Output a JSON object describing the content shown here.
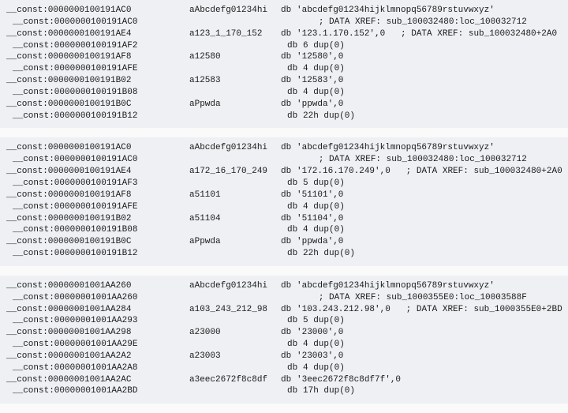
{
  "blocks": [
    {
      "rows": [
        {
          "label": "__const:0000000100191AC0",
          "sub": false,
          "symbol": "aAbcdefg01234hi",
          "kw": "db",
          "data": "'abcdefg01234hijklmnopq56789rstuvwxyz'",
          "xref": ""
        },
        {
          "label": "__const:0000000100191AC0",
          "sub": true,
          "symbol": "",
          "kw": "",
          "data": "",
          "xref": "; DATA XREF: sub_100032480:loc_100032712"
        },
        {
          "label": "__const:0000000100191AE4",
          "sub": false,
          "symbol": "a123_1_170_152",
          "kw": "db",
          "data": "'123.1.170.152',0",
          "xref": "; DATA XREF: sub_100032480+2A0"
        },
        {
          "label": "__const:0000000100191AF2",
          "sub": true,
          "symbol": "",
          "kw": "db",
          "data": "6 dup(0)",
          "xref": ""
        },
        {
          "label": "__const:0000000100191AF8",
          "sub": false,
          "symbol": "a12580",
          "kw": "db",
          "data": "'12580',0",
          "xref": ""
        },
        {
          "label": "__const:0000000100191AFE",
          "sub": true,
          "symbol": "",
          "kw": "db",
          "data": "4 dup(0)",
          "xref": ""
        },
        {
          "label": "__const:0000000100191B02",
          "sub": false,
          "symbol": "a12583",
          "kw": "db",
          "data": "'12583',0",
          "xref": ""
        },
        {
          "label": "__const:0000000100191B08",
          "sub": true,
          "symbol": "",
          "kw": "db",
          "data": "4 dup(0)",
          "xref": ""
        },
        {
          "label": "__const:0000000100191B0C",
          "sub": false,
          "symbol": "aPpwda",
          "kw": "db",
          "data": "'ppwda',0",
          "xref": ""
        },
        {
          "label": "__const:0000000100191B12",
          "sub": true,
          "symbol": "",
          "kw": "db",
          "data": "22h dup(0)",
          "xref": ""
        }
      ]
    },
    {
      "rows": [
        {
          "label": "__const:0000000100191AC0",
          "sub": false,
          "symbol": "aAbcdefg01234hi",
          "kw": "db",
          "data": "'abcdefg01234hijklmnopq56789rstuvwxyz'",
          "xref": ""
        },
        {
          "label": "__const:0000000100191AC0",
          "sub": true,
          "symbol": "",
          "kw": "",
          "data": "",
          "xref": "; DATA XREF: sub_100032480:loc_100032712"
        },
        {
          "label": "__const:0000000100191AE4",
          "sub": false,
          "symbol": "a172_16_170_249",
          "kw": "db",
          "data": "'172.16.170.249',0",
          "xref": "; DATA XREF: sub_100032480+2A0"
        },
        {
          "label": "__const:0000000100191AF3",
          "sub": true,
          "symbol": "",
          "kw": "db",
          "data": "5 dup(0)",
          "xref": ""
        },
        {
          "label": "__const:0000000100191AF8",
          "sub": false,
          "symbol": "a51101",
          "kw": "db",
          "data": "'51101',0",
          "xref": ""
        },
        {
          "label": "__const:0000000100191AFE",
          "sub": true,
          "symbol": "",
          "kw": "db",
          "data": "4 dup(0)",
          "xref": ""
        },
        {
          "label": "__const:0000000100191B02",
          "sub": false,
          "symbol": "a51104",
          "kw": "db",
          "data": "'51104',0",
          "xref": ""
        },
        {
          "label": "__const:0000000100191B08",
          "sub": true,
          "symbol": "",
          "kw": "db",
          "data": "4 dup(0)",
          "xref": ""
        },
        {
          "label": "__const:0000000100191B0C",
          "sub": false,
          "symbol": "aPpwda",
          "kw": "db",
          "data": "'ppwda',0",
          "xref": ""
        },
        {
          "label": "__const:0000000100191B12",
          "sub": true,
          "symbol": "",
          "kw": "db",
          "data": "22h dup(0)",
          "xref": ""
        }
      ]
    },
    {
      "rows": [
        {
          "label": "__const:00000001001AA260",
          "sub": false,
          "symbol": "aAbcdefg01234hi",
          "kw": "db",
          "data": "'abcdefg01234hijklmnopq56789rstuvwxyz'",
          "xref": ""
        },
        {
          "label": "__const:00000001001AA260",
          "sub": true,
          "symbol": "",
          "kw": "",
          "data": "",
          "xref": "; DATA XREF: sub_1000355E0:loc_10003588F"
        },
        {
          "label": "__const:00000001001AA284",
          "sub": false,
          "symbol": "a103_243_212_98",
          "kw": "db",
          "data": "'103.243.212.98',0",
          "xref": "; DATA XREF: sub_1000355E0+2BD"
        },
        {
          "label": "__const:00000001001AA293",
          "sub": true,
          "symbol": "",
          "kw": "db",
          "data": "5 dup(0)",
          "xref": ""
        },
        {
          "label": "__const:00000001001AA298",
          "sub": false,
          "symbol": "a23000",
          "kw": "db",
          "data": "'23000',0",
          "xref": ""
        },
        {
          "label": "__const:00000001001AA29E",
          "sub": true,
          "symbol": "",
          "kw": "db",
          "data": "4 dup(0)",
          "xref": ""
        },
        {
          "label": "__const:00000001001AA2A2",
          "sub": false,
          "symbol": "a23003",
          "kw": "db",
          "data": "'23003',0",
          "xref": ""
        },
        {
          "label": "__const:00000001001AA2A8",
          "sub": true,
          "symbol": "",
          "kw": "db",
          "data": "4 dup(0)",
          "xref": ""
        },
        {
          "label": "__const:00000001001AA2AC",
          "sub": false,
          "symbol": "a3eec2672f8c8df",
          "kw": "db",
          "data": "'3eec2672f8c8df7f',0",
          "xref": ""
        },
        {
          "label": "__const:00000001001AA2BD",
          "sub": true,
          "symbol": "",
          "kw": "db",
          "data": "17h dup(0)",
          "xref": ""
        }
      ]
    }
  ]
}
